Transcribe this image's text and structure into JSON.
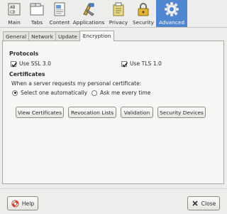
{
  "toolbar": {
    "items": [
      {
        "label": "Main",
        "icon": "main-icon"
      },
      {
        "label": "Tabs",
        "icon": "tabs-icon"
      },
      {
        "label": "Content",
        "icon": "content-icon"
      },
      {
        "label": "Applications",
        "icon": "applications-icon"
      },
      {
        "label": "Privacy",
        "icon": "privacy-icon"
      },
      {
        "label": "Security",
        "icon": "security-icon"
      },
      {
        "label": "Advanced",
        "icon": "gear-icon",
        "selected": true
      }
    ]
  },
  "tabs": [
    "General",
    "Network",
    "Update",
    "Encryption"
  ],
  "active_tab": "Encryption",
  "protocols": {
    "title": "Protocols",
    "ssl_label": "Use SSL 3.0",
    "ssl_checked": true,
    "tls_label": "Use TLS 1.0",
    "tls_checked": true
  },
  "certificates": {
    "title": "Certificates",
    "prompt": "When a server requests my personal certificate:",
    "option_auto": "Select one automatically",
    "option_ask": "Ask me every time",
    "selected": "auto"
  },
  "buttons": {
    "view_certificates": "View Certificates",
    "revocation_lists": "Revocation Lists",
    "validation": "Validation",
    "security_devices": "Security Devices"
  },
  "footer": {
    "help_label": "Help",
    "close_label": "Close"
  },
  "colors": {
    "selected_toolbar": "#4f86cf",
    "window_bg": "#ededeb"
  }
}
